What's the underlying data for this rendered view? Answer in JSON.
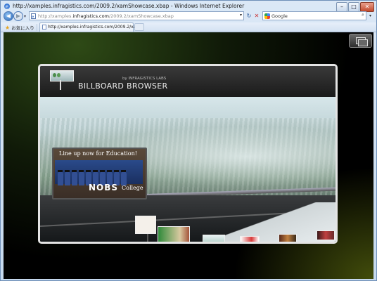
{
  "window": {
    "title": "http://xamples.infragistics.com/2009.2/xamShowcase.xbap - Windows Internet Explorer",
    "controls": {
      "minimize": "–",
      "maximize": "□",
      "close": "✕"
    }
  },
  "navbar": {
    "back": "◀",
    "forward": "▶",
    "address_prefix": "http://xamples.",
    "address_domain": "infragistics.com",
    "address_rest": "/2009.2/xamShowcase.xbap",
    "address_dropdown": "▾",
    "refresh": "↻",
    "stop": "✕",
    "search_engine": "Google",
    "search_button": "⌕",
    "search_dropdown": "▾"
  },
  "favorites_bar": {
    "favorites_label": "お気に入り",
    "tab_title": "http://xamples.infragistics.com/2009.2/xa..."
  },
  "app": {
    "header": {
      "brand": "BILLBOARD BROWSER",
      "brand_small": "by INFRAGISTICS LABS"
    },
    "featured_billboard": {
      "headline": "Line up now for Education!",
      "name": "NOBS",
      "sub": "College"
    },
    "nav": {
      "prev": "‹",
      "next": "›"
    }
  },
  "colors": {
    "accent": "#2f63c6",
    "panel_border": "#e4e4e4",
    "background": "#000000"
  }
}
